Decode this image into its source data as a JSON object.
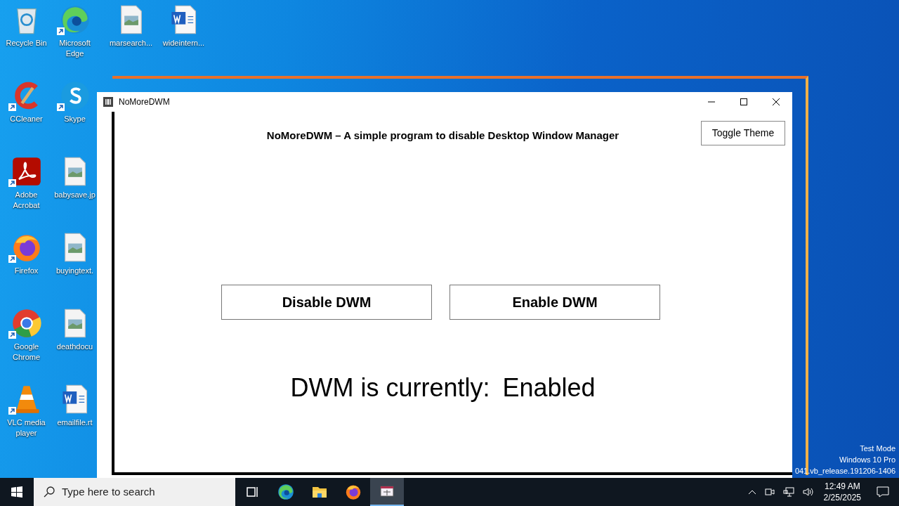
{
  "desktop_icons": [
    {
      "label": "Recycle Bin",
      "kind": "recycle",
      "shortcut": false
    },
    {
      "label": "Microsoft Edge",
      "kind": "edge",
      "shortcut": true
    },
    {
      "label": "marsearch...",
      "kind": "image",
      "shortcut": false
    },
    {
      "label": "wideintern...",
      "kind": "word",
      "shortcut": false
    },
    {
      "label": "CCleaner",
      "kind": "ccleaner",
      "shortcut": true
    },
    {
      "label": "Skype",
      "kind": "skype",
      "shortcut": true
    },
    {
      "label": "Adobe Acrobat",
      "kind": "acrobat",
      "shortcut": true
    },
    {
      "label": "babysave.jp",
      "kind": "image",
      "shortcut": false
    },
    {
      "label": "Firefox",
      "kind": "firefox",
      "shortcut": true
    },
    {
      "label": "buyingtext.",
      "kind": "image",
      "shortcut": false
    },
    {
      "label": "Google Chrome",
      "kind": "chrome",
      "shortcut": true
    },
    {
      "label": "deathdocu",
      "kind": "image",
      "shortcut": false
    },
    {
      "label": "VLC media player",
      "kind": "vlc",
      "shortcut": true
    },
    {
      "label": "emailfile.rt",
      "kind": "word",
      "shortcut": false
    }
  ],
  "window": {
    "title": "NoMoreDWM",
    "heading": "NoMoreDWM – A simple program to disable Desktop Window Manager",
    "toggle_button": "Toggle Theme",
    "buttons": [
      "Disable DWM",
      "Enable DWM"
    ],
    "status_label": "DWM is currently:",
    "status_value": "Enabled"
  },
  "desktop_notice": [
    "Test Mode",
    "Windows 10 Pro",
    "041.vb_release.191206-1406"
  ],
  "taskbar": {
    "search_placeholder": "Type here to search",
    "apps": [
      {
        "kind": "taskview",
        "selected": false
      },
      {
        "kind": "edge",
        "selected": false
      },
      {
        "kind": "folder",
        "selected": false
      },
      {
        "kind": "firefox",
        "selected": false
      },
      {
        "kind": "app",
        "selected": true
      }
    ],
    "time": "12:49 AM",
    "date": "2/25/2025"
  }
}
